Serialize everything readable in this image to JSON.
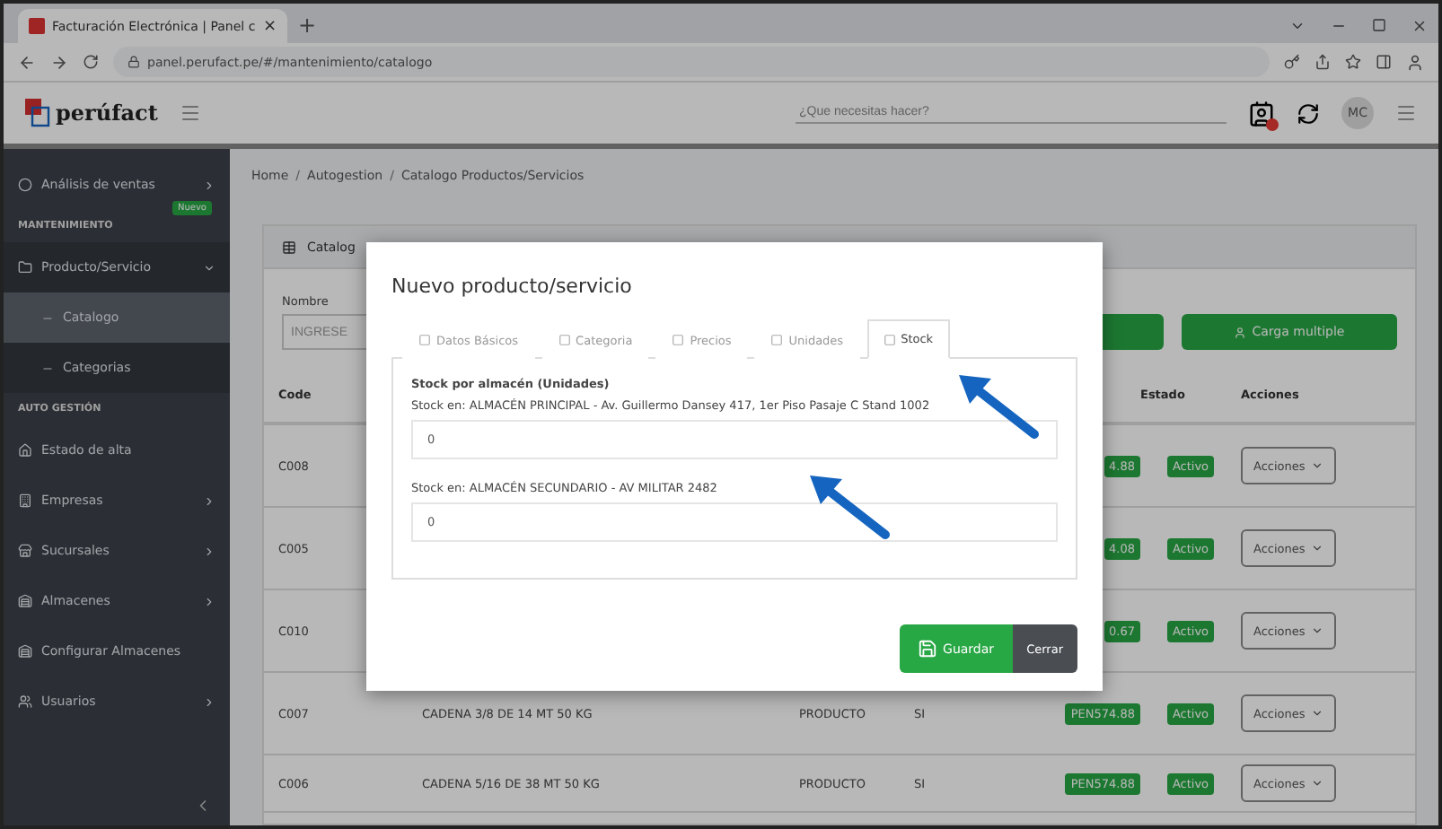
{
  "browser": {
    "tab_title": "Facturación Electrónica | Panel c",
    "tab_close": "×",
    "new_tab": "+",
    "url": "panel.perufact.pe/#/mantenimiento/catalogo"
  },
  "header": {
    "logo": "perúfact",
    "search": {
      "placeholder": "¿Que necesitas hacer?"
    },
    "avatar": "MC"
  },
  "sidebar": {
    "items": [
      {
        "kind": "item",
        "label": "Análisis de ventas",
        "badge": "Nuevo",
        "chevron": true,
        "selected": false
      },
      {
        "kind": "section",
        "label": "MANTENIMIENTO"
      },
      {
        "kind": "item",
        "label": "Producto/Servicio",
        "chevron": true,
        "selected": false,
        "expanded": true,
        "children": [
          {
            "label": "Catalogo",
            "selected": true
          },
          {
            "label": "Categorias",
            "selected": false
          }
        ]
      },
      {
        "kind": "section",
        "label": "AUTO GESTIÓN"
      },
      {
        "kind": "item",
        "label": "Estado de alta",
        "chevron": false,
        "selected": false
      },
      {
        "kind": "item",
        "label": "Empresas",
        "chevron": true,
        "selected": false
      },
      {
        "kind": "item",
        "label": "Sucursales",
        "chevron": true,
        "selected": false
      },
      {
        "kind": "item",
        "label": "Almacenes",
        "chevron": true,
        "selected": false
      },
      {
        "kind": "item",
        "label": "Configurar Almacenes",
        "chevron": false,
        "selected": false
      },
      {
        "kind": "item",
        "label": "Usuarios",
        "chevron": true,
        "selected": false
      }
    ]
  },
  "breadcrumb": {
    "items": [
      "Home",
      "Autogestion",
      "Catalogo Productos/Servicios"
    ],
    "separator": "/"
  },
  "card": {
    "title": "Catalog",
    "filter_label": "Nombre",
    "filter_placeholder": "INGRESE",
    "bulk_button": "Carga multiple"
  },
  "table": {
    "columns": [
      {
        "label": "Code",
        "kind": "code"
      },
      {
        "label": "Estado",
        "kind": "status"
      },
      {
        "label": "Acciones",
        "kind": "action"
      }
    ],
    "rows": [
      {
        "code": "C008",
        "price": "4.88",
        "status": "Activo",
        "action": "Acciones"
      },
      {
        "code": "C005",
        "price": "4.08",
        "status": "Activo",
        "action": "Acciones"
      },
      {
        "code": "C010",
        "price": "0.67",
        "status": "Activo",
        "action": "Acciones"
      },
      {
        "code": "C007",
        "name": "CADENA 3/8 DE 14 MT 50 KG",
        "type": "PRODUCTO",
        "flag": "SI",
        "price": "PEN574.88",
        "status": "Activo",
        "action": "Acciones"
      },
      {
        "code": "C006",
        "name": "CADENA 5/16 DE 38 MT 50 KG",
        "type": "PRODUCTO",
        "flag": "SI",
        "price": "PEN574.88",
        "status": "Activo",
        "action": "Acciones"
      }
    ]
  },
  "modal": {
    "title": "Nuevo producto/servicio",
    "tabs": [
      {
        "label": "Datos Básicos",
        "selected": false
      },
      {
        "label": "Categoria",
        "selected": false
      },
      {
        "label": "Precios",
        "selected": false
      },
      {
        "label": "Unidades",
        "selected": false
      },
      {
        "label": "Stock",
        "selected": true
      }
    ],
    "section_title": "Stock por almacén (Unidades)",
    "fields": [
      {
        "label": "Stock en: ALMACÉN PRINCIPAL - Av. Guillermo Dansey 417, 1er Piso Pasaje C Stand 1002",
        "value": "0"
      },
      {
        "label": "Stock en: ALMACÉN SECUNDARIO - AV MILITAR 2482",
        "value": "0"
      }
    ],
    "save_button": "Guardar",
    "close_button": "Cerrar"
  }
}
